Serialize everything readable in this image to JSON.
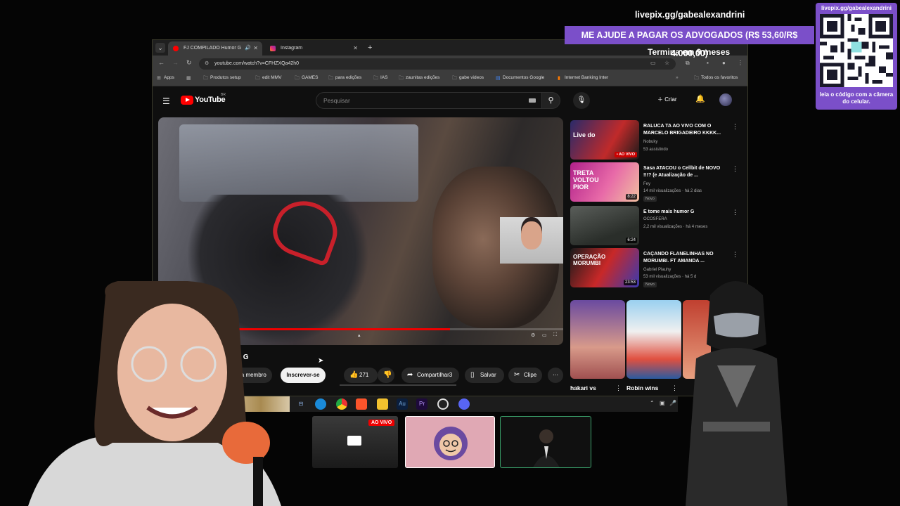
{
  "browser": {
    "tabs": [
      {
        "label": "FJ COMPILADO Humor G",
        "active": true
      },
      {
        "label": "Instagram",
        "active": false
      }
    ],
    "url": "youtube.com/watch?v=CFHZXQa42h0",
    "bookmarks": [
      "Apps",
      "Produtos setup",
      "edit MMV",
      "GAMES",
      "para edições",
      "IAS",
      "zaunitas edições",
      "gabe videos",
      "Documentos Google",
      "Internet Banking Inter"
    ],
    "all_bookmarks": "Todos os favoritos"
  },
  "youtube": {
    "logo_text": "YouTube",
    "country": "BR",
    "search_placeholder": "Pesquisar",
    "create_label": "Criar",
    "video_title_fragment": "or G",
    "join_label": "Seja membro",
    "subscribe_label": "Inscrever-se",
    "likes": "271",
    "share_label": "Compartilhar3",
    "save_label": "Salvar",
    "clip_label": "Clipe",
    "progress": 0.72
  },
  "recommendations": [
    {
      "title": "RALUCA TA AO VIVO COM O MARCELO BRIGADEIRO KKKK...",
      "channel": "Nobuky",
      "meta": "53 assistindo",
      "live": "AO VIVO",
      "thumb_text": "Live do"
    },
    {
      "title": "Sasa ATACOU o Cellbit de NOVO !!!? (e Atualização de ...",
      "channel": "Fey",
      "meta": "14 mil visualizações · há 2 dias",
      "badge": "Novo",
      "duration": "8:22",
      "thumb_text": "TRETA VOLTOU PIOR"
    },
    {
      "title": "E tome mais humor G",
      "channel": "OCOSFERA",
      "meta": "2,2 mil visualizações · há 4 meses",
      "duration": "6:24"
    },
    {
      "title": "CAÇANDO FLANELINHAS NO MORUMBI. FT AMANDA ...",
      "channel": "Gabriel Plauhy",
      "meta": "53 mil visualizações · há 5 d",
      "badge": "Novo",
      "duration": "23:53",
      "thumb_text": "OPERAÇÃO MORUMBI"
    }
  ],
  "shorts": [
    {
      "label": "hakari vs"
    },
    {
      "label": "Robin wins"
    }
  ],
  "overlay": {
    "handle": "livepix.gg/gabealexandrini",
    "banner": "ME AJUDE A PAGAR OS ADVOGADOS (R$ 53,60/R$ 4.000,00)",
    "timer": "Termina em 9 meses",
    "qr_handle": "livepix.gg/gabealexandrini",
    "qr_hint": "leia o código com a câmera do celular."
  },
  "calls": {
    "live_tag": "AO VIVO"
  },
  "colors": {
    "accent_purple": "#7b4fc9",
    "youtube_red": "#ff0000",
    "live_red": "#cc0000"
  }
}
